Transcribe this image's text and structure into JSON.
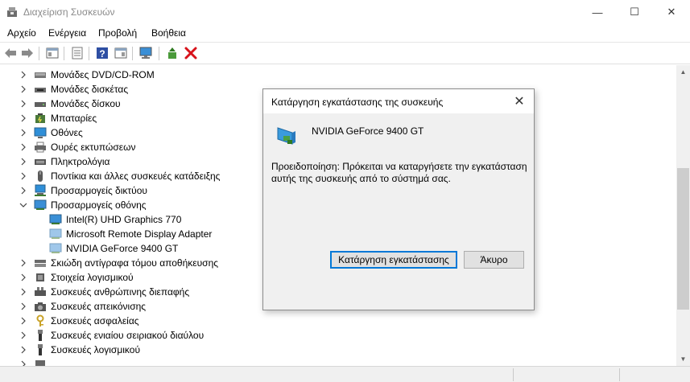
{
  "window": {
    "title": "Διαχείριση Συσκευών",
    "minimize_glyph": "—",
    "maximize_glyph": "☐",
    "close_glyph": "✕"
  },
  "menu": [
    "Αρχείο",
    "Ενέργεια",
    "Προβολή",
    "Βοήθεια"
  ],
  "toolbar": {
    "icons": [
      "back-arrow-icon",
      "forward-arrow-icon",
      "console-tree-icon",
      "properties-icon",
      "help-icon",
      "action-pane-icon",
      "scan-hardware-icon",
      "update-driver-icon",
      "uninstall-device-icon"
    ]
  },
  "tree": {
    "items": [
      {
        "label": "Μονάδες DVD/CD-ROM",
        "icon": "dvd-drive-icon",
        "state": "collapsed"
      },
      {
        "label": "Μονάδες δισκέτας",
        "icon": "floppy-drive-icon",
        "state": "collapsed"
      },
      {
        "label": "Μονάδες δίσκου",
        "icon": "disk-drive-icon",
        "state": "collapsed"
      },
      {
        "label": "Μπαταρίες",
        "icon": "battery-icon",
        "state": "collapsed"
      },
      {
        "label": "Οθόνες",
        "icon": "monitor-icon",
        "state": "collapsed"
      },
      {
        "label": "Ουρές εκτυπώσεων",
        "icon": "printer-queue-icon",
        "state": "collapsed"
      },
      {
        "label": "Πληκτρολόγια",
        "icon": "keyboard-icon",
        "state": "collapsed"
      },
      {
        "label": "Ποντίκια και άλλες συσκευές κατάδειξης",
        "icon": "mouse-icon",
        "state": "collapsed"
      },
      {
        "label": "Προσαρμογείς δικτύου",
        "icon": "network-adapter-icon",
        "state": "collapsed"
      },
      {
        "label": "Προσαρμογείς οθόνης",
        "icon": "display-adapter-icon",
        "state": "expanded"
      },
      {
        "label": "Intel(R) UHD Graphics 770",
        "icon": "display-adapter-icon",
        "state": "child"
      },
      {
        "label": "Microsoft Remote Display Adapter",
        "icon": "display-adapter-icon",
        "state": "child"
      },
      {
        "label": "NVIDIA GeForce 9400 GT",
        "icon": "display-adapter-icon",
        "state": "child"
      },
      {
        "label": "Σκιώδη αντίγραφα τόμου αποθήκευσης",
        "icon": "storage-volume-icon",
        "state": "collapsed"
      },
      {
        "label": "Στοιχεία λογισμικού",
        "icon": "software-component-icon",
        "state": "collapsed"
      },
      {
        "label": "Συσκευές ανθρώπινης διεπαφής",
        "icon": "hid-icon",
        "state": "collapsed"
      },
      {
        "label": "Συσκευές απεικόνισης",
        "icon": "imaging-device-icon",
        "state": "collapsed"
      },
      {
        "label": "Συσκευές ασφαλείας",
        "icon": "security-device-icon",
        "state": "collapsed"
      },
      {
        "label": "Συσκευές ενιαίου σειριακού διαύλου",
        "icon": "usb-icon",
        "state": "collapsed"
      },
      {
        "label": "Συσκευές λογισμικού",
        "icon": "software-device-icon",
        "state": "collapsed"
      }
    ]
  },
  "dialog": {
    "title": "Κατάργηση εγκατάστασης της συσκευής",
    "device_name": "NVIDIA GeForce 9400 GT",
    "warning": "Προειδοποίηση: Πρόκειται να καταργήσετε την εγκατάσταση αυτής της συσκευής από το σύστημά σας.",
    "uninstall_button": "Κατάργηση εγκατάστασης",
    "cancel_button": "Άκυρο",
    "close_glyph": "✕"
  },
  "colors": {
    "accent": "#0078d7",
    "dialog_bg": "#f0f0f0",
    "title_text": "#8a8a8a",
    "uninstall_red": "#d8131b"
  }
}
